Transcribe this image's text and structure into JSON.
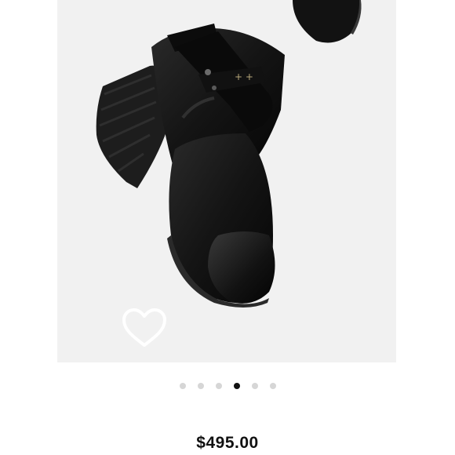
{
  "product": {
    "image_icon": "boot-photo",
    "favorite_icon": "heart-outline-icon",
    "price": "$495.00"
  },
  "carousel": {
    "count": 6,
    "active_index": 3
  },
  "colors": {
    "image_background": "#f1f1f1",
    "dot_inactive": "#d6d6d6",
    "dot_active": "#111111",
    "price_text": "#111111"
  }
}
